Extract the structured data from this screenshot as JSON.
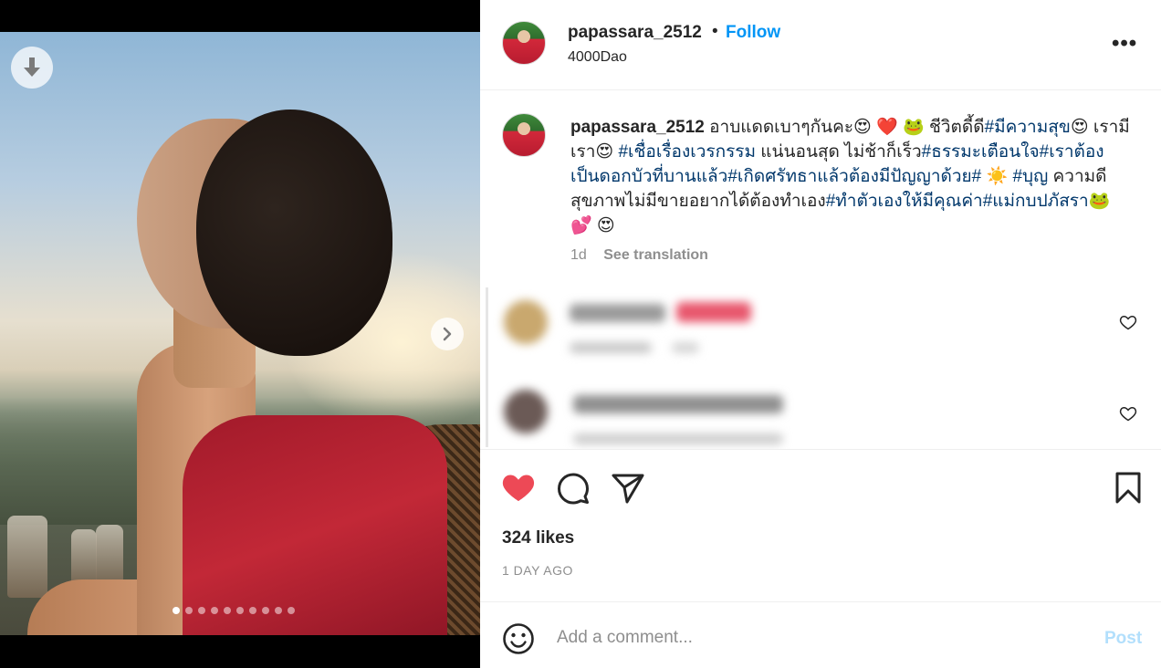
{
  "media": {
    "slide_count": 10,
    "active_slide": 0,
    "download_icon": "download-arrow-icon",
    "next_icon": "chevron-right-icon"
  },
  "header": {
    "username": "papassara_2512",
    "separator": "•",
    "follow_label": "Follow",
    "location": "4000Dao",
    "more_icon": "more-horizontal-icon",
    "more_label": "•••"
  },
  "caption": {
    "username": "papassara_2512",
    "segments": [
      {
        "text": " อาบแดดเบาๆกันคะ😍 ❤️ 🐸  ชีวิตดี้ดี",
        "tag": false
      },
      {
        "text": "#มีความสุข",
        "tag": true
      },
      {
        "text": "😍 ",
        "tag": false
      },
      {
        "text": "เรามีเรา",
        "tag": false
      },
      {
        "text": "😍 ",
        "tag": false
      },
      {
        "text": "#เชื่อเรื่องเวรกรรม",
        "tag": true
      },
      {
        "text": " แน่นอนสุด ไม่ช้าก็เร็ว",
        "tag": false
      },
      {
        "text": "#ธรรมะเตือนใจ",
        "tag": true
      },
      {
        "text": "#เราต้องเป็นดอกบัวที่บานแล้ว",
        "tag": true
      },
      {
        "text": "#เกิดศรัทธาแล้วต้องมีปัญญาด้วย",
        "tag": true
      },
      {
        "text": "#",
        "tag": true
      },
      {
        "text": " ☀️ ",
        "tag": false
      },
      {
        "text": "#บุญ",
        "tag": true
      },
      {
        "text": " ความดี สุขภาพไม่มีขายอยากได้ต้องทำเอง",
        "tag": false
      },
      {
        "text": "#ทำตัวเองให้มีคุณค่า",
        "tag": true
      },
      {
        "text": "#แม่กบปภัสรา",
        "tag": true
      },
      {
        "text": "🐸 💕 😍",
        "tag": false
      }
    ],
    "age": "1d",
    "see_translation": "See translation"
  },
  "actions": {
    "like_icon": "heart-filled-icon",
    "comment_icon": "comment-bubble-icon",
    "share_icon": "paper-plane-icon",
    "save_icon": "bookmark-icon",
    "likes_text": "324 likes",
    "date_text": "1 DAY AGO",
    "liked_color": "#ed4956"
  },
  "composer": {
    "emoji_icon": "smiley-face-icon",
    "placeholder": "Add a comment...",
    "post_label": "Post",
    "post_color": "#b2dffc"
  },
  "colors": {
    "link": "#0095f6",
    "hashtag": "#00376b",
    "muted": "#8e8e8e"
  }
}
